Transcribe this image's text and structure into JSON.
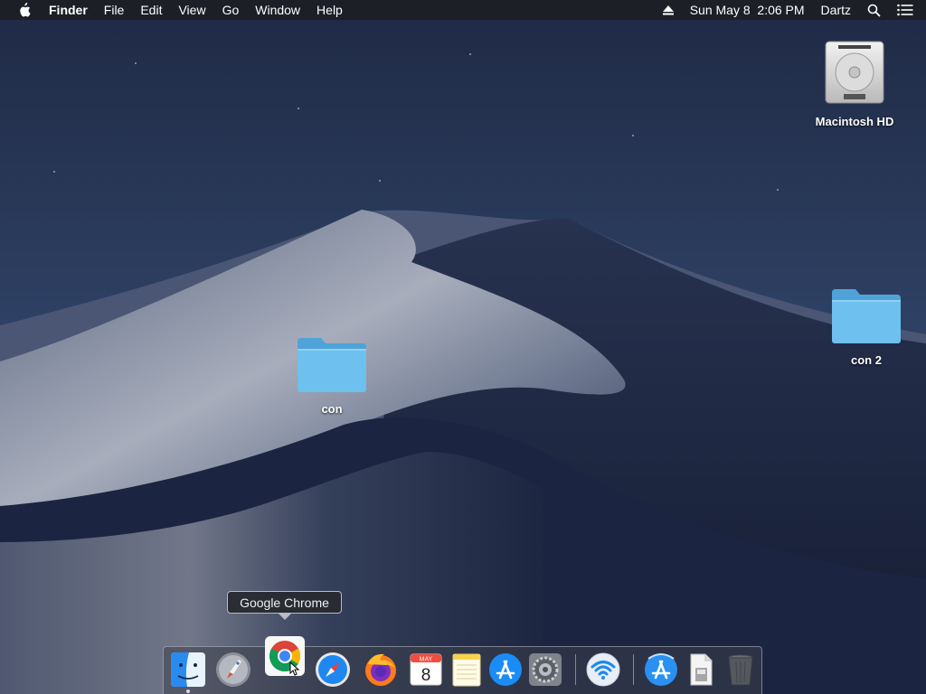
{
  "menubar": {
    "app_name": "Finder",
    "menus": [
      "File",
      "Edit",
      "View",
      "Go",
      "Window",
      "Help"
    ],
    "status": {
      "datetime": "Sun May 8  2:06 PM",
      "user": "Dartz",
      "icons": [
        "eject-icon",
        "spotlight-search-icon",
        "notification-center-icon"
      ]
    }
  },
  "desktop": {
    "icons": [
      {
        "label": "Macintosh HD",
        "icon": "hard-drive-icon"
      },
      {
        "label": "con 2",
        "icon": "folder-icon"
      },
      {
        "label": "con",
        "icon": "folder-icon"
      }
    ]
  },
  "tooltip": {
    "text": "Google Chrome"
  },
  "dock": {
    "items": [
      {
        "name": "Finder",
        "icon": "finder-icon",
        "running": true
      },
      {
        "name": "Launchpad",
        "icon": "launchpad-icon",
        "running": false
      },
      {
        "name": "Google Chrome",
        "icon": "chrome-icon",
        "running": false,
        "hovered": true
      },
      {
        "name": "Safari",
        "icon": "safari-icon",
        "running": false
      },
      {
        "name": "Firefox",
        "icon": "firefox-icon",
        "running": false
      },
      {
        "name": "Calendar",
        "icon": "calendar-icon",
        "running": false,
        "month": "MAY",
        "day": "8"
      },
      {
        "name": "Notes",
        "icon": "notes-icon",
        "running": false
      },
      {
        "name": "App Store",
        "icon": "app-store-icon",
        "running": false
      },
      {
        "name": "System Preferences",
        "icon": "system-preferences-icon",
        "running": false
      },
      {
        "name": "Wireless Diagnostics",
        "icon": "wifi-icon",
        "running": false
      },
      {
        "name": "Applications",
        "icon": "applications-folder-icon",
        "running": false
      },
      {
        "name": "Document",
        "icon": "document-icon",
        "running": false
      },
      {
        "name": "Trash",
        "icon": "trash-icon",
        "running": false
      }
    ]
  },
  "colors": {
    "menubar_bg": "#1c1e24",
    "folder_blue": "#5fb3e6",
    "accent_blue": "#1e88f0"
  }
}
